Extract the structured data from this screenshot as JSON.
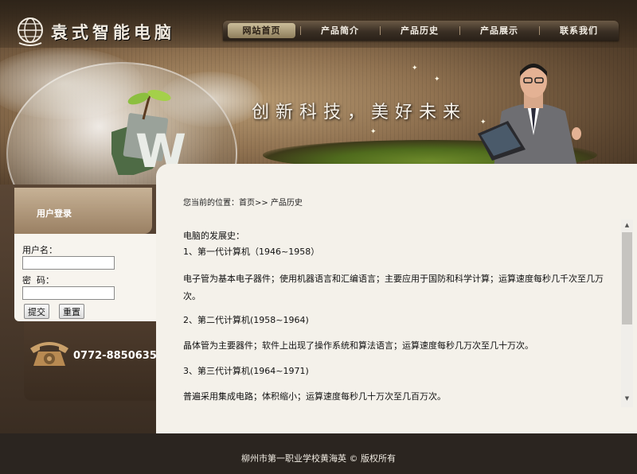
{
  "site": {
    "logo_text": "袁式智能电脑",
    "slogan": "创新科技，美好未来"
  },
  "nav": {
    "items": [
      {
        "label": "网站首页"
      },
      {
        "label": "产品简介"
      },
      {
        "label": "产品历史"
      },
      {
        "label": "产品展示"
      },
      {
        "label": "联系我们"
      }
    ]
  },
  "login": {
    "title": "用户登录",
    "username_label": "用户名：",
    "username_value": "",
    "password_label": "密  码：",
    "password_value": "",
    "submit_label": "提交",
    "reset_label": "重置"
  },
  "contact": {
    "phone": "0772-8850635"
  },
  "main": {
    "breadcrumb": "您当前的位置：首页>> 产品历史",
    "heading": "电脑的发展史：",
    "sections": [
      {
        "title": "1、第一代计算机（1946~1958）",
        "body": "电子管为基本电子器件；使用机器语言和汇编语言；主要应用于国防和科学计算；运算速度每秒几千次至几万次。"
      },
      {
        "title": "2、第二代计算机(1958~1964)",
        "body": "晶体管为主要器件；软件上出现了操作系统和算法语言；运算速度每秒几万次至几十万次。"
      },
      {
        "title": "3、第三代计算机(1964~1971)",
        "body": "普遍采用集成电路；体积缩小；运算速度每秒几十万次至几百万次。"
      }
    ]
  },
  "footer": {
    "text": "柳州市第一职业学校黄海英 © 版权所有"
  },
  "colors": {
    "banner_brown": "#8f7150",
    "content_bg": "#f4f1ea",
    "footer_bg": "#2b2520",
    "nav_active": "#cbbd9a"
  }
}
